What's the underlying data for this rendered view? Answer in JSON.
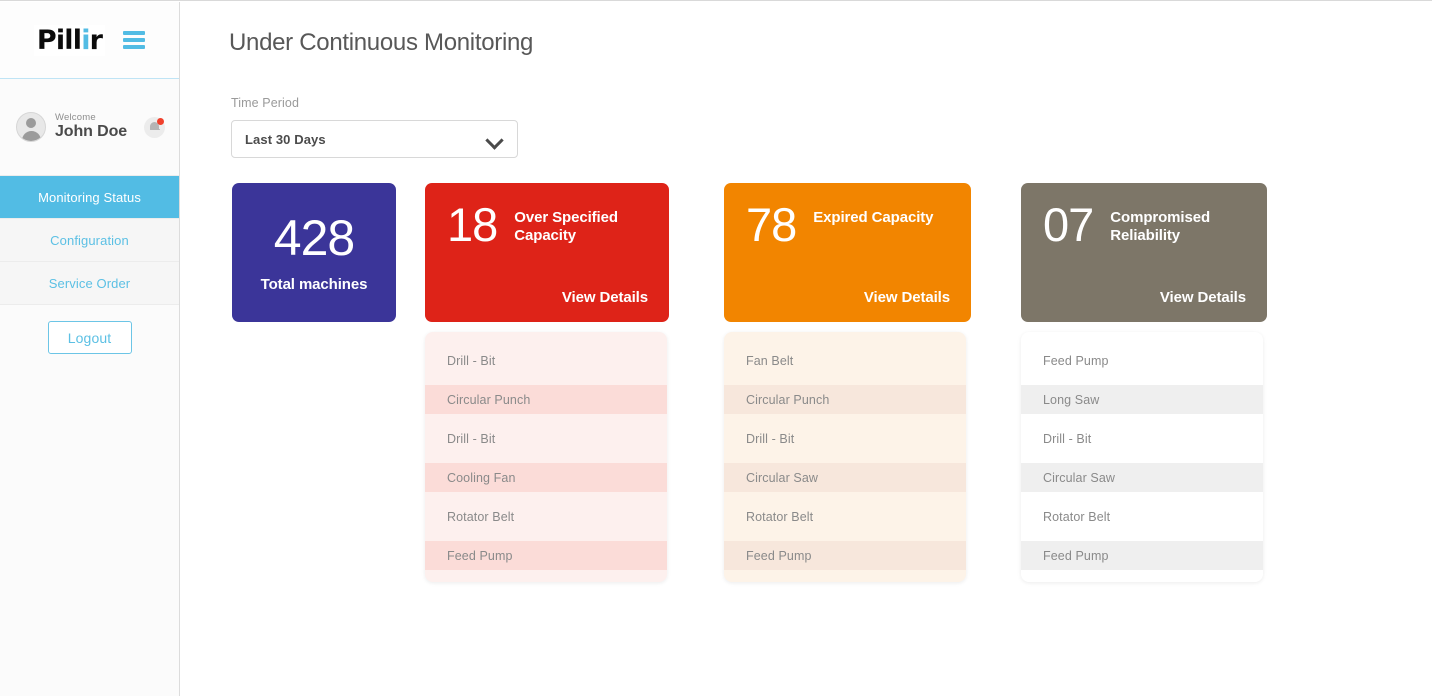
{
  "sidebar": {
    "logo": {
      "prefix": "Pill",
      "accent_letter": "i",
      "suffix": "r"
    },
    "menu_icon": "hamburger-menu-icon",
    "user": {
      "welcome_label": "Welcome",
      "name": "John Doe",
      "avatar_icon": "user-avatar-icon",
      "notification_icon": "bell-icon",
      "has_notification": true
    },
    "nav": [
      {
        "label": "Monitoring Status",
        "active": true
      },
      {
        "label": "Configuration",
        "active": false
      },
      {
        "label": "Service Order",
        "active": false
      }
    ],
    "logout_label": "Logout"
  },
  "header": {
    "title": "Under Continuous Monitoring"
  },
  "filter": {
    "label": "Time Period",
    "selected": "Last 30 Days",
    "chevron_icon": "chevron-down-icon",
    "options": [
      "Last 30 Days"
    ]
  },
  "cards": [
    {
      "id": "total-machines",
      "value": "428",
      "label": "Total machines",
      "color": "#3b3599",
      "has_link": false,
      "link_label": ""
    },
    {
      "id": "over-specified-capacity",
      "value": "18",
      "label": "Over Specified Capacity",
      "color": "#de2318",
      "has_link": true,
      "link_label": "View Details"
    },
    {
      "id": "expired-capacity",
      "value": "78",
      "label": "Expired Capacity",
      "color": "#f28500",
      "has_link": true,
      "link_label": "View Details"
    },
    {
      "id": "compromised-reliability",
      "value": "07",
      "label": "Compromised Reliability",
      "color": "#7d7668",
      "has_link": true,
      "link_label": "View Details"
    }
  ],
  "panels": [
    {
      "id": "over-specified-capacity-list",
      "base_color": "#fdf0ee",
      "stripe_color": "#fbdcd8",
      "items": [
        "Drill - Bit",
        "Circular Punch",
        "Drill - Bit",
        "Cooling Fan",
        "Rotator Belt",
        "Feed Pump"
      ]
    },
    {
      "id": "expired-capacity-list",
      "base_color": "#fdf3e8",
      "stripe_color": "#f7e7dc",
      "items": [
        "Fan Belt",
        "Circular Punch",
        "Drill - Bit",
        "Circular Saw",
        "Rotator Belt",
        "Feed Pump"
      ]
    },
    {
      "id": "compromised-reliability-list",
      "base_color": "#ffffff",
      "stripe_color": "#efefef",
      "items": [
        "Feed Pump",
        "Long Saw",
        "Drill - Bit",
        "Circular Saw",
        "Rotator Belt",
        "Feed Pump"
      ]
    }
  ]
}
